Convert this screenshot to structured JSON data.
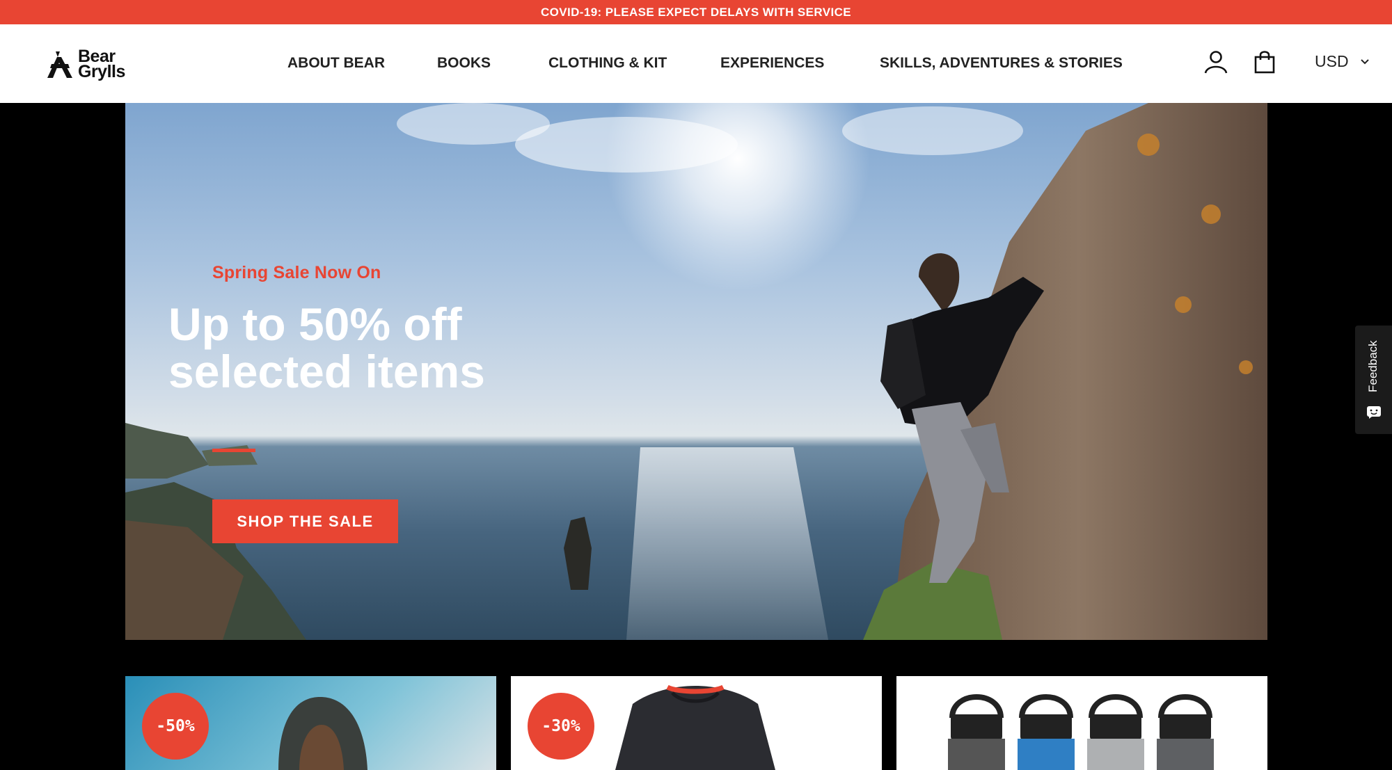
{
  "announcement": {
    "text": "COVID-19: PLEASE EXPECT DELAYS WITH SERVICE"
  },
  "header": {
    "logo": {
      "line1": "Bear",
      "line2": "Grylls"
    },
    "nav": [
      {
        "label": "ABOUT BEAR"
      },
      {
        "label": "BOOKS"
      },
      {
        "label": "CLOTHING & KIT"
      },
      {
        "label": "EXPERIENCES"
      },
      {
        "label": "SKILLS, ADVENTURES & STORIES"
      }
    ],
    "icons": {
      "account": "user-icon",
      "cart": "shopping-bag-icon"
    },
    "currency": "USD"
  },
  "hero": {
    "eyebrow": "Spring Sale Now On",
    "title": "Up to 50% off selected items",
    "cta": "SHOP THE SALE"
  },
  "feedback": {
    "label": "Feedback"
  },
  "cards": [
    {
      "badge": "-50%"
    },
    {
      "badge": "-30%"
    },
    {
      "badge": ""
    }
  ],
  "colors": {
    "accent": "#e84533",
    "header_bg": "#ffffff",
    "page_bg": "#000000"
  }
}
